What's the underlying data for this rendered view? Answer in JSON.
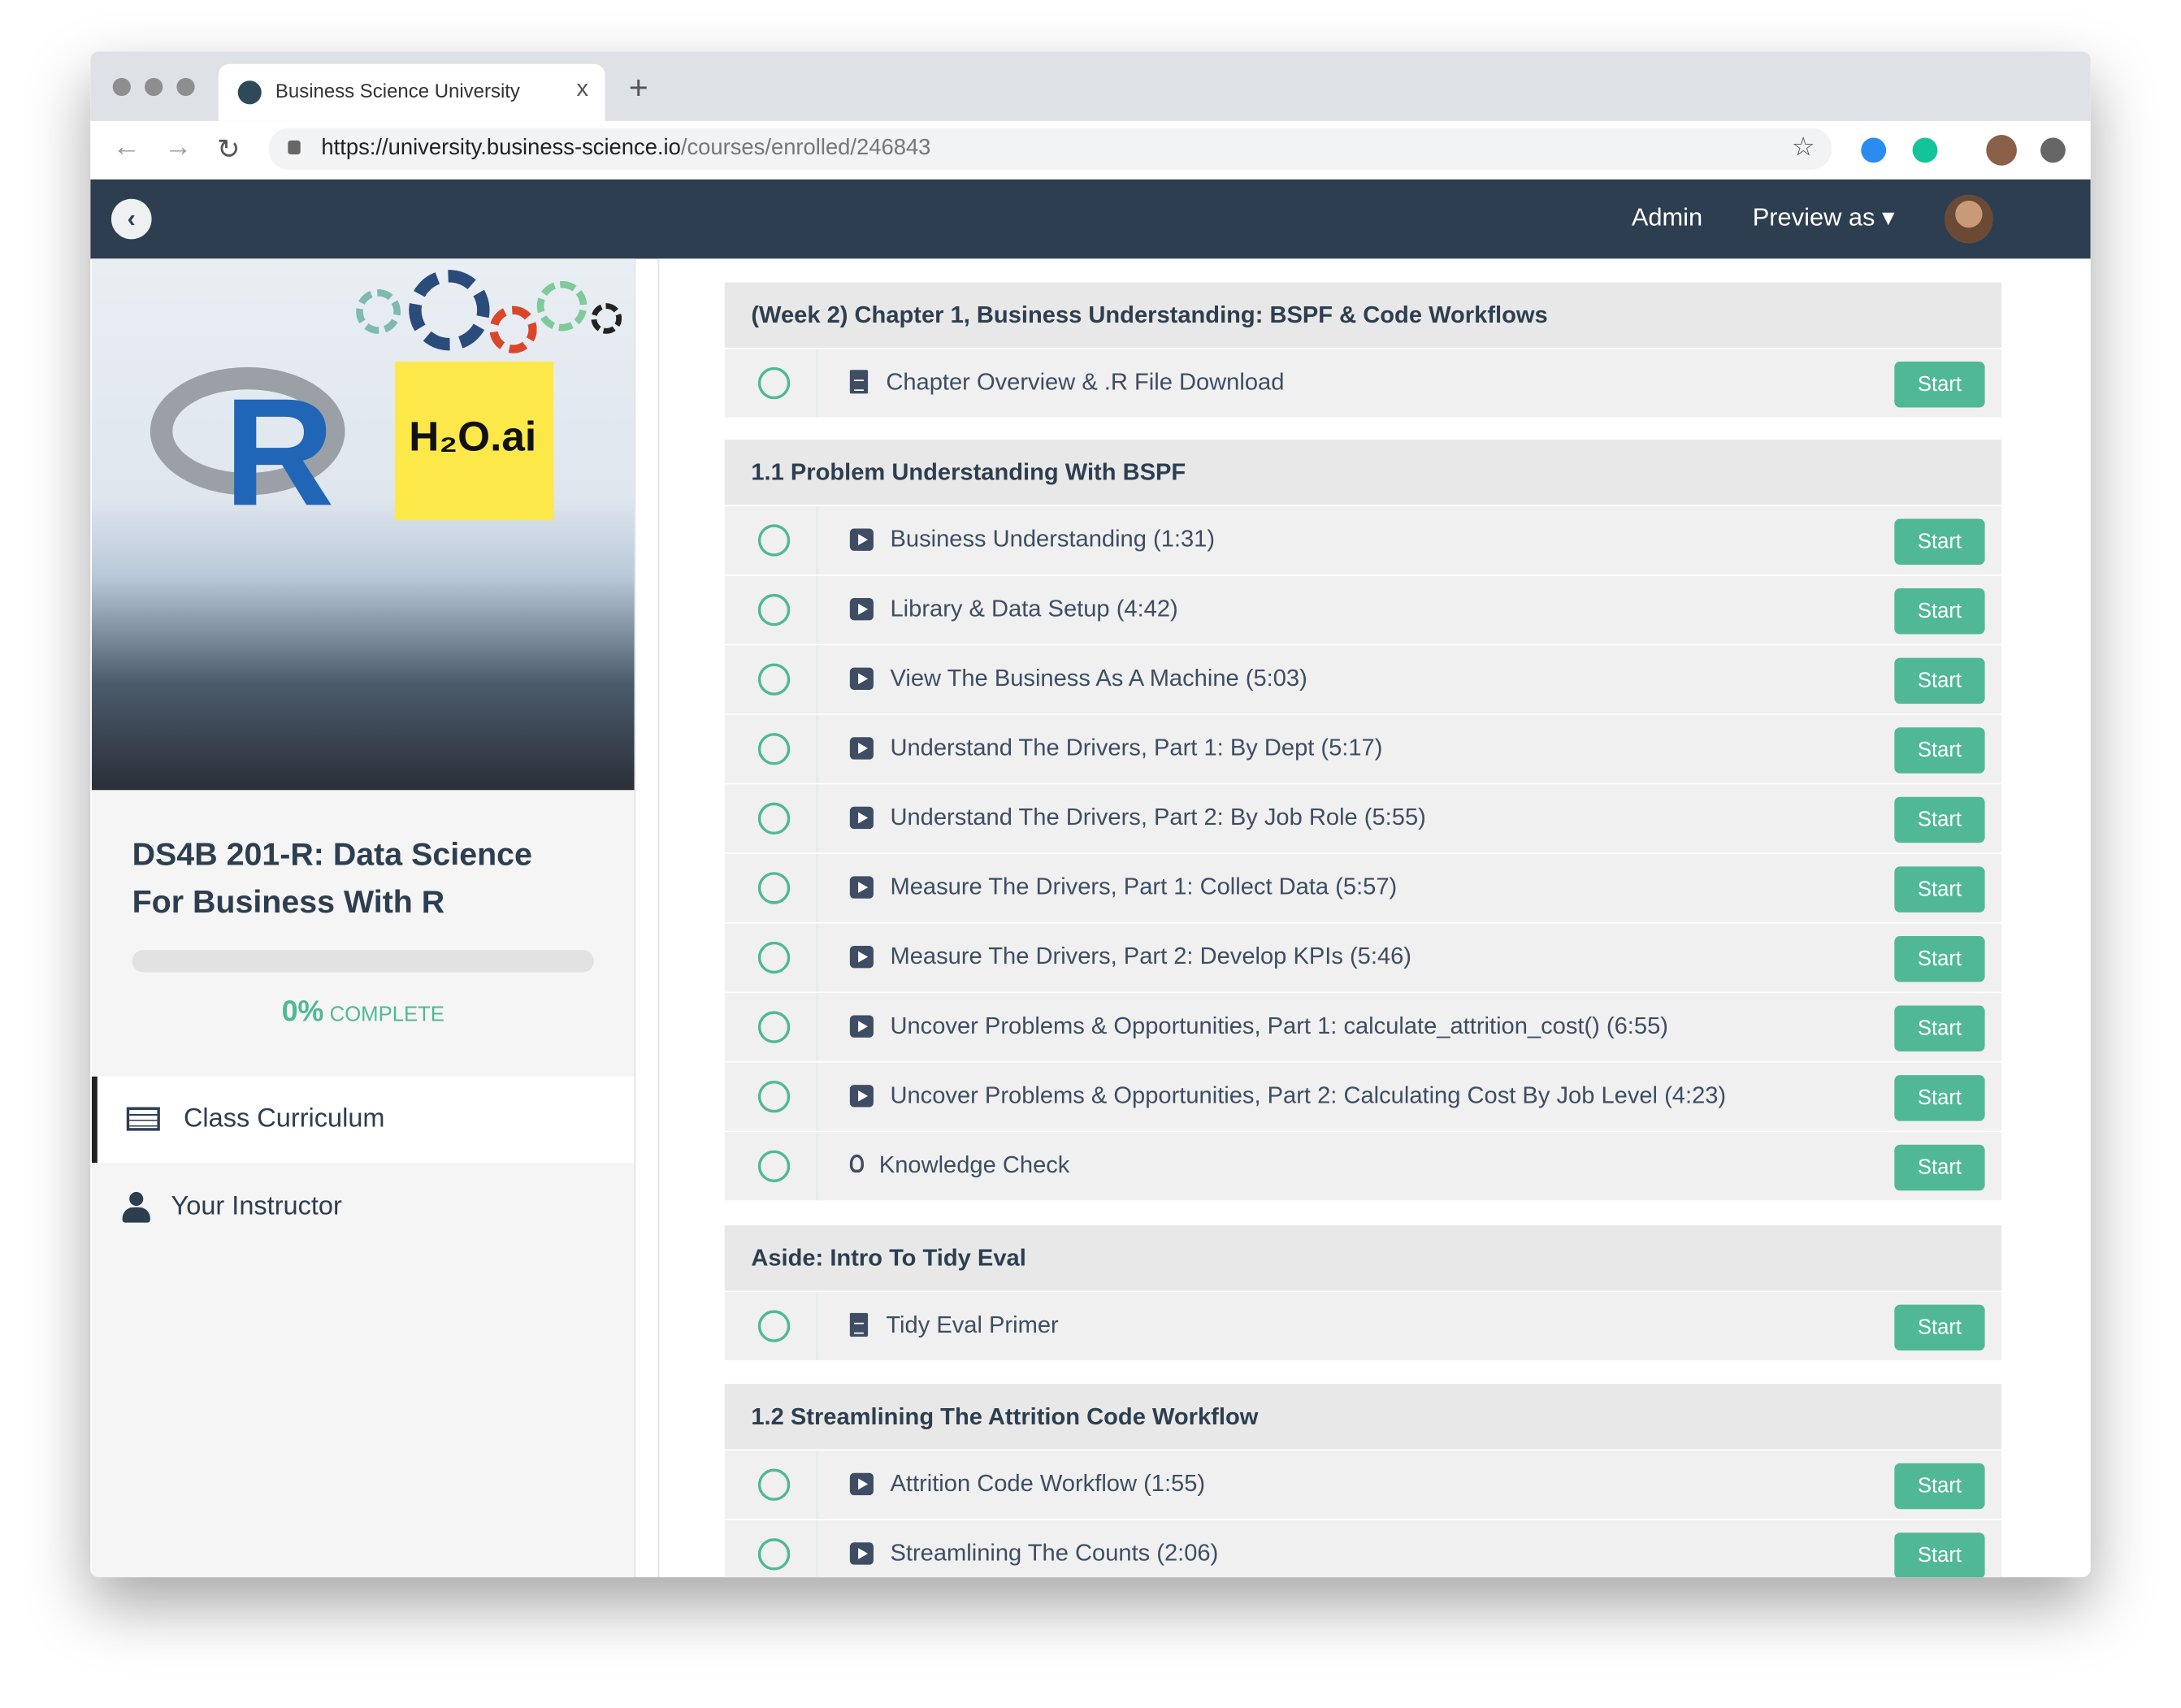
{
  "browser": {
    "tab_title": "Business Science University",
    "tab_close": "x",
    "new_tab": "+",
    "url_host": "https://university.business-science.io",
    "url_path": "/courses/enrolled/246843",
    "back": "←",
    "forward": "→",
    "reload": "↻",
    "bookmark": "☆"
  },
  "topnav": {
    "back": "‹",
    "admin": "Admin",
    "preview_as": "Preview as ▾"
  },
  "sidebar": {
    "image_text": {
      "letter": "R",
      "h2o": "H₂O.ai"
    },
    "course_title": "DS4B 201-R: Data Science For Business With R",
    "progress_percent": 0,
    "progress_value": "0%",
    "progress_label": "COMPLETE",
    "menu": [
      {
        "label": "Class Curriculum",
        "icon": "list-icon",
        "active": true
      },
      {
        "label": "Your Instructor",
        "icon": "user-icon",
        "active": false
      }
    ]
  },
  "accent": "#50b897",
  "sections": [
    {
      "title": "(Week 2) Chapter 1, Business Understanding: BSPF & Code Workflows",
      "lectures": [
        {
          "type": "doc",
          "title": "Chapter Overview & .R File Download",
          "action": "Start"
        }
      ]
    },
    {
      "title": "1.1 Problem Understanding With BSPF",
      "lectures": [
        {
          "type": "video",
          "title": "Business Understanding (1:31)",
          "action": "Start"
        },
        {
          "type": "video",
          "title": "Library & Data Setup (4:42)",
          "action": "Start"
        },
        {
          "type": "video",
          "title": "View The Business As A Machine (5:03)",
          "action": "Start"
        },
        {
          "type": "video",
          "title": "Understand The Drivers, Part 1: By Dept (5:17)",
          "action": "Start"
        },
        {
          "type": "video",
          "title": "Understand The Drivers, Part 2: By Job Role (5:55)",
          "action": "Start"
        },
        {
          "type": "video",
          "title": "Measure The Drivers, Part 1: Collect Data (5:57)",
          "action": "Start"
        },
        {
          "type": "video",
          "title": "Measure The Drivers, Part 2: Develop KPIs (5:46)",
          "action": "Start"
        },
        {
          "type": "video",
          "title": "Uncover Problems & Opportunities, Part 1: calculate_attrition_cost() (6:55)",
          "action": "Start"
        },
        {
          "type": "video",
          "title": "Uncover Problems & Opportunities, Part 2: Calculating Cost By Job Level (4:23)",
          "action": "Start"
        },
        {
          "type": "quiz",
          "title": "Knowledge Check",
          "action": "Start"
        }
      ]
    },
    {
      "title": "Aside: Intro To Tidy Eval",
      "lectures": [
        {
          "type": "doc",
          "title": "Tidy Eval Primer",
          "action": "Start"
        }
      ]
    },
    {
      "title": "1.2 Streamlining The Attrition Code Workflow",
      "lectures": [
        {
          "type": "video",
          "title": "Attrition Code Workflow (1:55)",
          "action": "Start"
        },
        {
          "type": "video",
          "title": "Streamlining The Counts (2:06)",
          "action": "Start"
        }
      ]
    }
  ]
}
